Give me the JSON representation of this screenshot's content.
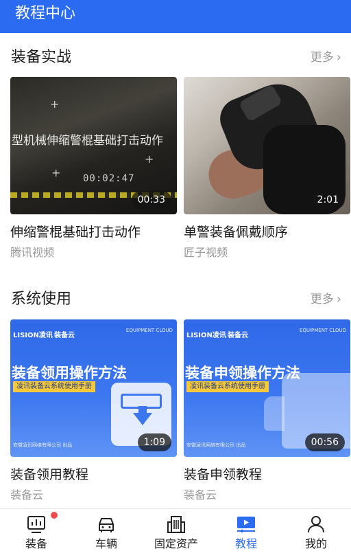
{
  "header": {
    "title": "教程中心"
  },
  "sections": [
    {
      "title": "装备实战",
      "more_label": "更多",
      "cards": [
        {
          "duration": "00:33",
          "title": "伸缩警棍基础打击动作",
          "source": "腾讯视频",
          "thumb_text": "型机械伸缩警棍基础打击动作",
          "thumb_timecode": "00:02:47"
        },
        {
          "duration": "2:01",
          "title": "单警装备佩戴顺序",
          "source": "匠子视频"
        }
      ]
    },
    {
      "title": "系统使用",
      "more_label": "更多",
      "cards": [
        {
          "duration": "1:09",
          "title": "装备领用教程",
          "source": "装备云",
          "thumb_brand": "LISION凌讯",
          "thumb_brand2": "装备云",
          "thumb_corner": "EQUIPMENT CLOUD",
          "thumb_heading": "装备领用操作方法",
          "thumb_tag": "凌讯装备云系统使用手册",
          "thumb_company": "安徽凌讯网络有限公司 出品"
        },
        {
          "duration": "00:56",
          "title": "装备申领教程",
          "source": "装备云",
          "thumb_brand": "LISION凌讯",
          "thumb_brand2": "装备云",
          "thumb_corner": "EQUIPMENT CLOUD",
          "thumb_heading": "装备申领操作方法",
          "thumb_tag": "凌讯装备云系统使用手册",
          "thumb_company": "安徽凌讯网络有限公司 出品"
        }
      ]
    }
  ],
  "bottom_nav": {
    "active_index": 3,
    "active_color": "#2a6bf2",
    "badge_color": "#f04a4a",
    "items": [
      {
        "label": "装备",
        "icon": "chart-icon",
        "badge": true
      },
      {
        "label": "车辆",
        "icon": "car-icon"
      },
      {
        "label": "固定资产",
        "icon": "building-icon"
      },
      {
        "label": "教程",
        "icon": "video-icon"
      },
      {
        "label": "我的",
        "icon": "user-icon"
      }
    ]
  },
  "colors": {
    "header": "#2a6bf2",
    "muted_text": "#9a9a9a"
  }
}
